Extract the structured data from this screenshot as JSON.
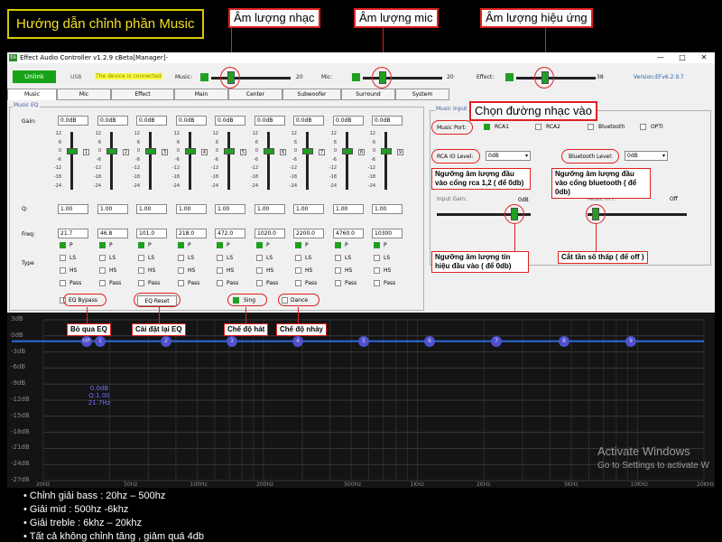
{
  "guide_title": "Hướng dẫn chỉnh phần Music",
  "callouts": {
    "music_volume": "Âm lượng nhạc",
    "mic_volume": "Âm lượng mic",
    "effect_volume": "Âm lượng hiệu ứng",
    "input_select": "Chọn đường nhạc vào",
    "rca_level": "Ngưỡng âm lượng đầu vào cổng rca 1,2 ( để 0db)",
    "bt_level": "Ngưỡng âm lượng đầu vào cổng bluetooth ( để 0db)",
    "input_gain": "Ngưỡng âm lượng tín hiệu đầu vào ( để 0db)",
    "hpf": "Cắt tần số thấp ( để off )",
    "eq_bypass": "Bỏ qua EQ",
    "eq_reset": "Cài đặt lại EQ",
    "sing": "Chế độ hát",
    "dance": "Chế độ nhảy"
  },
  "window": {
    "title": "Effect Audio Controller  v1.2.9 cBeta[Manager]-",
    "min": "—",
    "max": "□",
    "close": "✕",
    "unlink": "Unlink",
    "usb": "USB",
    "connected": "The device is connected",
    "music_label": "Music:",
    "music_value": "20",
    "mic_label": "Mic:",
    "mic_value": "20",
    "effect_label": "Effect:",
    "effect_value": "38",
    "version": "Version:EFv6.2.9.7"
  },
  "tabs": [
    "Music",
    "Mic",
    "Effect",
    "Main",
    "Center",
    "Subwoofer",
    "Surround",
    "System"
  ],
  "music_eq": {
    "label": "Music EQ",
    "gain_label": "Gain:",
    "q_label": "Q:",
    "freq_label": "Freq:",
    "type_label": "Type",
    "ticks": [
      "12",
      "6",
      "0",
      "-6",
      "-12",
      "-18",
      "-24"
    ],
    "bands": [
      {
        "gain": "0.0dB",
        "q": "1.00",
        "freq": "21.7",
        "num": "1",
        "type": "P"
      },
      {
        "gain": "0.0dB",
        "q": "1.00",
        "freq": "46.8",
        "num": "2",
        "type": "P"
      },
      {
        "gain": "0.0dB",
        "q": "1.00",
        "freq": "101.0",
        "num": "3",
        "type": "P"
      },
      {
        "gain": "0.0dB",
        "q": "1.00",
        "freq": "218.0",
        "num": "4",
        "type": "P"
      },
      {
        "gain": "0.0dB",
        "q": "1.00",
        "freq": "472.0",
        "num": "5",
        "type": "P"
      },
      {
        "gain": "0.0dB",
        "q": "1.00",
        "freq": "1020.0",
        "num": "6",
        "type": "P"
      },
      {
        "gain": "0.0dB",
        "q": "1.00",
        "freq": "2200.0",
        "num": "7",
        "type": "P"
      },
      {
        "gain": "0.0dB",
        "q": "1.00",
        "freq": "4760.0",
        "num": "8",
        "type": "P"
      },
      {
        "gain": "0.0dB",
        "q": "1.00",
        "freq": "10300",
        "num": "9",
        "type": "P"
      }
    ],
    "type_options": [
      "P",
      "LS",
      "HS",
      "Pass"
    ],
    "eq_bypass": "EQ Bypass",
    "eq_reset": "EQ Reset",
    "sing": "Sing",
    "dance": "Dance"
  },
  "music_input": {
    "label": "Music Input",
    "port_label": "Music Port:",
    "ports": [
      "RCA1",
      "RCA2",
      "Bluetooth",
      "OPTI"
    ],
    "selected_port": "RCA1",
    "rca_level_label": "RCA IO Level:",
    "rca_level_value": "0dB",
    "bt_level_label": "Bluetooth Level:",
    "bt_level_value": "0dB",
    "input_gain_label": "Input Gain:",
    "input_gain_value": "0dB",
    "hpf_label": "Music HPF:",
    "hpf_value": "Off"
  },
  "graph": {
    "y_labels": [
      "3dB",
      "0dB",
      "-3dB",
      "-6dB",
      "-9dB",
      "-12dB",
      "-15dB",
      "-18dB",
      "-21dB",
      "-24dB",
      "-27dB"
    ],
    "x_labels": [
      "20Hz",
      "50Hz",
      "100Hz",
      "200Hz",
      "500Hz",
      "1KHz",
      "2KHz",
      "5KHz",
      "10KHz",
      "20KHz"
    ],
    "nodes": [
      "HP",
      "1",
      "2",
      "3",
      "4",
      "5",
      "6",
      "7",
      "8",
      "9"
    ],
    "node_info": [
      "0.0dB",
      "Q:1.00",
      "21.7Hz"
    ],
    "activate_title": "Activate Windows",
    "activate_sub": "Go to Settings to activate W"
  },
  "notes": [
    "Chỉnh giải bass : 20hz – 500hz",
    "Giải mid : 500hz -6khz",
    "Giải treble : 6khz – 20khz",
    "Tất cả không chỉnh tăng , giảm quá 4db"
  ]
}
